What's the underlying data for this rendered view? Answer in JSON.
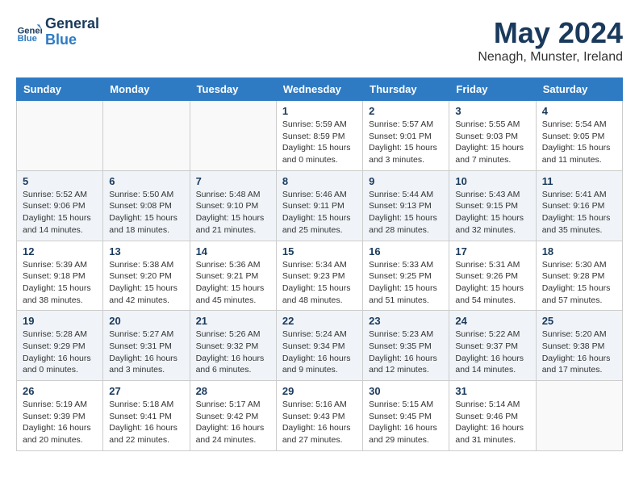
{
  "header": {
    "logo_general": "General",
    "logo_blue": "Blue",
    "month": "May 2024",
    "location": "Nenagh, Munster, Ireland"
  },
  "weekdays": [
    "Sunday",
    "Monday",
    "Tuesday",
    "Wednesday",
    "Thursday",
    "Friday",
    "Saturday"
  ],
  "weeks": [
    [
      {
        "day": "",
        "info": ""
      },
      {
        "day": "",
        "info": ""
      },
      {
        "day": "",
        "info": ""
      },
      {
        "day": "1",
        "info": "Sunrise: 5:59 AM\nSunset: 8:59 PM\nDaylight: 15 hours\nand 0 minutes."
      },
      {
        "day": "2",
        "info": "Sunrise: 5:57 AM\nSunset: 9:01 PM\nDaylight: 15 hours\nand 3 minutes."
      },
      {
        "day": "3",
        "info": "Sunrise: 5:55 AM\nSunset: 9:03 PM\nDaylight: 15 hours\nand 7 minutes."
      },
      {
        "day": "4",
        "info": "Sunrise: 5:54 AM\nSunset: 9:05 PM\nDaylight: 15 hours\nand 11 minutes."
      }
    ],
    [
      {
        "day": "5",
        "info": "Sunrise: 5:52 AM\nSunset: 9:06 PM\nDaylight: 15 hours\nand 14 minutes."
      },
      {
        "day": "6",
        "info": "Sunrise: 5:50 AM\nSunset: 9:08 PM\nDaylight: 15 hours\nand 18 minutes."
      },
      {
        "day": "7",
        "info": "Sunrise: 5:48 AM\nSunset: 9:10 PM\nDaylight: 15 hours\nand 21 minutes."
      },
      {
        "day": "8",
        "info": "Sunrise: 5:46 AM\nSunset: 9:11 PM\nDaylight: 15 hours\nand 25 minutes."
      },
      {
        "day": "9",
        "info": "Sunrise: 5:44 AM\nSunset: 9:13 PM\nDaylight: 15 hours\nand 28 minutes."
      },
      {
        "day": "10",
        "info": "Sunrise: 5:43 AM\nSunset: 9:15 PM\nDaylight: 15 hours\nand 32 minutes."
      },
      {
        "day": "11",
        "info": "Sunrise: 5:41 AM\nSunset: 9:16 PM\nDaylight: 15 hours\nand 35 minutes."
      }
    ],
    [
      {
        "day": "12",
        "info": "Sunrise: 5:39 AM\nSunset: 9:18 PM\nDaylight: 15 hours\nand 38 minutes."
      },
      {
        "day": "13",
        "info": "Sunrise: 5:38 AM\nSunset: 9:20 PM\nDaylight: 15 hours\nand 42 minutes."
      },
      {
        "day": "14",
        "info": "Sunrise: 5:36 AM\nSunset: 9:21 PM\nDaylight: 15 hours\nand 45 minutes."
      },
      {
        "day": "15",
        "info": "Sunrise: 5:34 AM\nSunset: 9:23 PM\nDaylight: 15 hours\nand 48 minutes."
      },
      {
        "day": "16",
        "info": "Sunrise: 5:33 AM\nSunset: 9:25 PM\nDaylight: 15 hours\nand 51 minutes."
      },
      {
        "day": "17",
        "info": "Sunrise: 5:31 AM\nSunset: 9:26 PM\nDaylight: 15 hours\nand 54 minutes."
      },
      {
        "day": "18",
        "info": "Sunrise: 5:30 AM\nSunset: 9:28 PM\nDaylight: 15 hours\nand 57 minutes."
      }
    ],
    [
      {
        "day": "19",
        "info": "Sunrise: 5:28 AM\nSunset: 9:29 PM\nDaylight: 16 hours\nand 0 minutes."
      },
      {
        "day": "20",
        "info": "Sunrise: 5:27 AM\nSunset: 9:31 PM\nDaylight: 16 hours\nand 3 minutes."
      },
      {
        "day": "21",
        "info": "Sunrise: 5:26 AM\nSunset: 9:32 PM\nDaylight: 16 hours\nand 6 minutes."
      },
      {
        "day": "22",
        "info": "Sunrise: 5:24 AM\nSunset: 9:34 PM\nDaylight: 16 hours\nand 9 minutes."
      },
      {
        "day": "23",
        "info": "Sunrise: 5:23 AM\nSunset: 9:35 PM\nDaylight: 16 hours\nand 12 minutes."
      },
      {
        "day": "24",
        "info": "Sunrise: 5:22 AM\nSunset: 9:37 PM\nDaylight: 16 hours\nand 14 minutes."
      },
      {
        "day": "25",
        "info": "Sunrise: 5:20 AM\nSunset: 9:38 PM\nDaylight: 16 hours\nand 17 minutes."
      }
    ],
    [
      {
        "day": "26",
        "info": "Sunrise: 5:19 AM\nSunset: 9:39 PM\nDaylight: 16 hours\nand 20 minutes."
      },
      {
        "day": "27",
        "info": "Sunrise: 5:18 AM\nSunset: 9:41 PM\nDaylight: 16 hours\nand 22 minutes."
      },
      {
        "day": "28",
        "info": "Sunrise: 5:17 AM\nSunset: 9:42 PM\nDaylight: 16 hours\nand 24 minutes."
      },
      {
        "day": "29",
        "info": "Sunrise: 5:16 AM\nSunset: 9:43 PM\nDaylight: 16 hours\nand 27 minutes."
      },
      {
        "day": "30",
        "info": "Sunrise: 5:15 AM\nSunset: 9:45 PM\nDaylight: 16 hours\nand 29 minutes."
      },
      {
        "day": "31",
        "info": "Sunrise: 5:14 AM\nSunset: 9:46 PM\nDaylight: 16 hours\nand 31 minutes."
      },
      {
        "day": "",
        "info": ""
      }
    ]
  ]
}
